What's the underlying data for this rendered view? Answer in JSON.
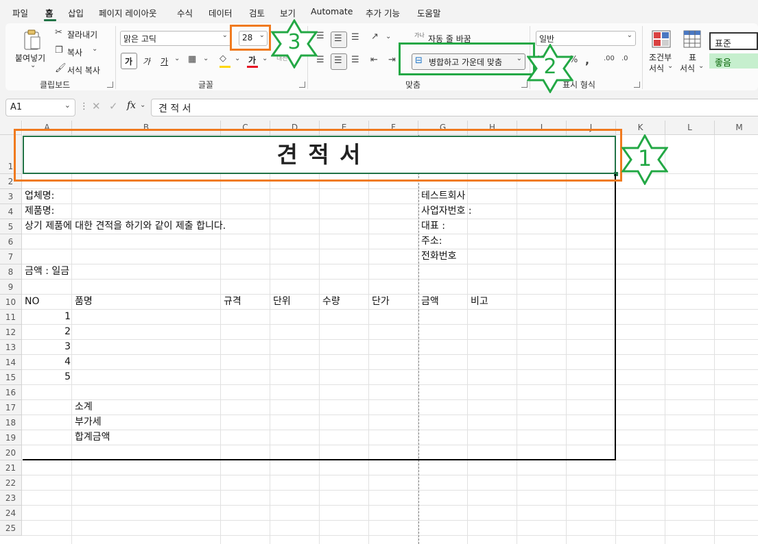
{
  "menu": {
    "items": [
      "파일",
      "홈",
      "삽입",
      "페이지 레이아웃",
      "수식",
      "데이터",
      "검토",
      "보기",
      "Automate",
      "추가 기능",
      "도움말"
    ],
    "active": "홈"
  },
  "ribbon": {
    "clipboard": {
      "paste": "붙여넣기",
      "cut": "잘라내기",
      "copy": "복사",
      "format_painter": "서식 복사",
      "label": "클립보드"
    },
    "font": {
      "name": "맑은 고딕",
      "size": "28",
      "bold": "가",
      "italic": "가",
      "underline": "가",
      "font_color_glyph": "가",
      "label": "글꼴"
    },
    "alignment": {
      "wrap_text": "자동 줄 바꿈",
      "merge_center": "병합하고 가운데 맞춤",
      "label": "맞춤"
    },
    "number": {
      "format": "일반",
      "label": "표시 형식"
    },
    "styles": {
      "conditional": "조건부\n서식",
      "conditional_line1": "조건부",
      "conditional_line2": "서식",
      "table_line1": "표",
      "table_line2": "서식",
      "normal": "표준",
      "good": "좋음"
    }
  },
  "formula_bar": {
    "name_box": "A1",
    "fx": "fx",
    "content": "견 적 서"
  },
  "grid": {
    "columns": [
      "A",
      "B",
      "C",
      "D",
      "E",
      "F",
      "G",
      "H",
      "I",
      "J",
      "K",
      "L",
      "M"
    ],
    "rows": [
      "1",
      "2",
      "3",
      "4",
      "5",
      "6",
      "7",
      "8",
      "9",
      "10",
      "11",
      "12",
      "13",
      "14",
      "15",
      "16",
      "17",
      "18",
      "19",
      "20",
      "21",
      "22",
      "23",
      "24",
      "25"
    ],
    "title": "견 적 서",
    "cells": {
      "a3": "업체명:",
      "a4": "제품명:",
      "a5": "상기 제품에 대한 견적을 하기와 같이 제출 합니다.",
      "g3": "테스트회사",
      "g4": "사업자번호 :",
      "g5": "대표 :",
      "g6": "주소:",
      "g7": "전화번호",
      "a8": "금액 : 일금",
      "a10": "NO",
      "b10": "품명",
      "c10": "규격",
      "d10": "단위",
      "e10": "수량",
      "f10": "단가",
      "g10": "금액",
      "h10": "비고",
      "a11": "1",
      "a12": "2",
      "a13": "3",
      "a14": "4",
      "a15": "5",
      "b17": "소계",
      "b18": "부가세",
      "b19": "합계금액"
    }
  },
  "annotations": {
    "star1": "1",
    "star2": "2",
    "star3": "3",
    "highlight_orange": "#F07A1E",
    "highlight_green": "#23A845"
  },
  "colors": {
    "accent": "#217346",
    "selection_border": "#217346",
    "font_color_bar": "#E81123",
    "fill_bar": "#FFD700",
    "good_bg": "#C6EFCE",
    "good_text": "#006100"
  }
}
